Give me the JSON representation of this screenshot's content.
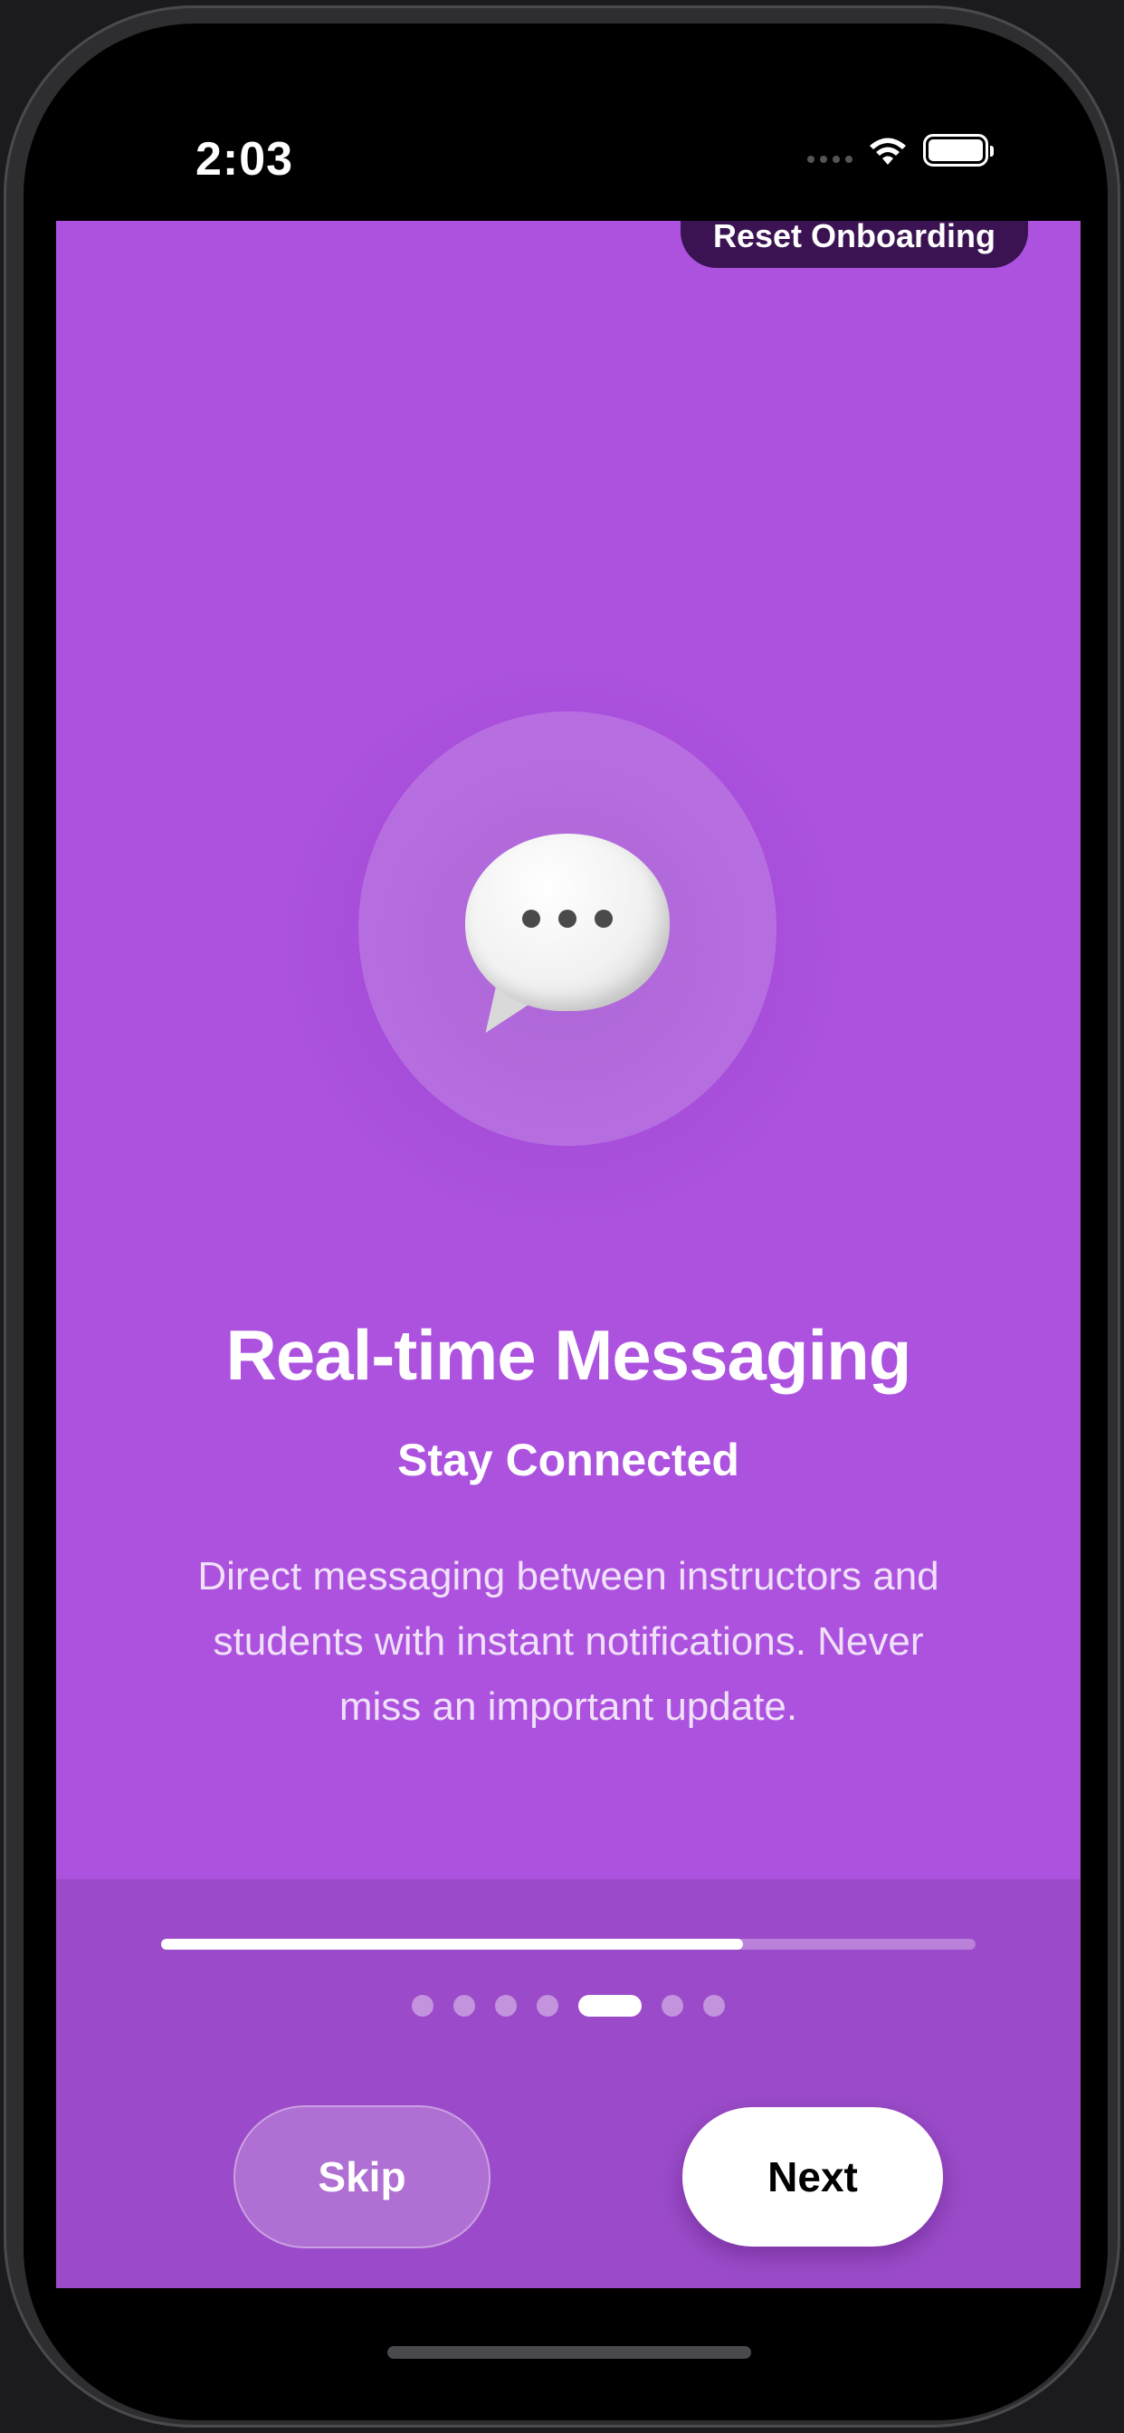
{
  "status_bar": {
    "time": "2:03",
    "icons": [
      "cellular-signal-icon",
      "wifi-icon",
      "battery-icon"
    ]
  },
  "reset_button": {
    "label": "Reset Onboarding"
  },
  "hero": {
    "icon": "speech-bubble-icon"
  },
  "content": {
    "title": "Real-time Messaging",
    "subtitle": "Stay Connected",
    "description": "Direct messaging between instructors and students with instant notifications. Never miss an important update."
  },
  "progress": {
    "fraction": 0.714
  },
  "pagination": {
    "total": 7,
    "active_index": 4
  },
  "actions": {
    "skip_label": "Skip",
    "next_label": "Next"
  },
  "colors": {
    "background": "#ac52df",
    "panel": "#9b4bc9",
    "reset_button": "#3b1352",
    "next_button": "#ffffff"
  }
}
